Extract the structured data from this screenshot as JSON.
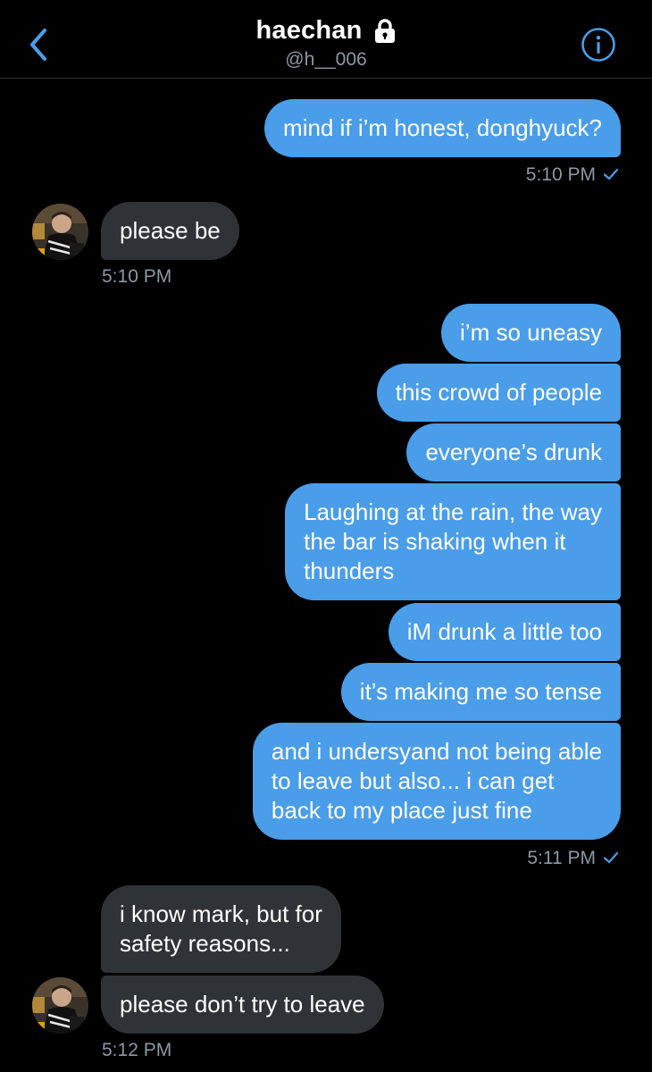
{
  "header": {
    "back_icon": "chevron-left-icon",
    "title": "haechan",
    "lock_icon": "lock-icon",
    "handle": "@h__006",
    "info_icon": "info-icon",
    "accent_color": "#4a9de8"
  },
  "colors": {
    "sent_bubble": "#4a9de8",
    "received_bubble": "#2f3336",
    "background": "#000000",
    "meta_text": "#8b98a5"
  },
  "messages": [
    {
      "direction": "sent",
      "text": "mind if i’m honest, donghyuck?"
    },
    {
      "direction": "sent",
      "meta": "5:10 PM",
      "read_icon": "checkmark-icon"
    },
    {
      "direction": "received",
      "text": "please be"
    },
    {
      "direction": "received",
      "meta": "5:10 PM"
    },
    {
      "direction": "sent",
      "text": "i’m so uneasy"
    },
    {
      "direction": "sent",
      "text": "this crowd of people"
    },
    {
      "direction": "sent",
      "text": "everyone’s drunk"
    },
    {
      "direction": "sent",
      "lines": [
        "Laughing at the rain, the way",
        "the bar is shaking when it",
        "thunders"
      ]
    },
    {
      "direction": "sent",
      "text": "iM drunk a little too"
    },
    {
      "direction": "sent",
      "text": "it’s making me so tense"
    },
    {
      "direction": "sent",
      "lines": [
        "and i undersyand not being able",
        "to leave but also... i can get",
        "back to my place just fine"
      ]
    },
    {
      "direction": "sent",
      "meta": "5:11 PM",
      "read_icon": "checkmark-icon"
    },
    {
      "direction": "received",
      "lines": [
        "i know mark, but for",
        "safety reasons..."
      ]
    },
    {
      "direction": "received",
      "text": "please don’t try to leave"
    },
    {
      "direction": "received",
      "meta": "5:12 PM"
    }
  ]
}
